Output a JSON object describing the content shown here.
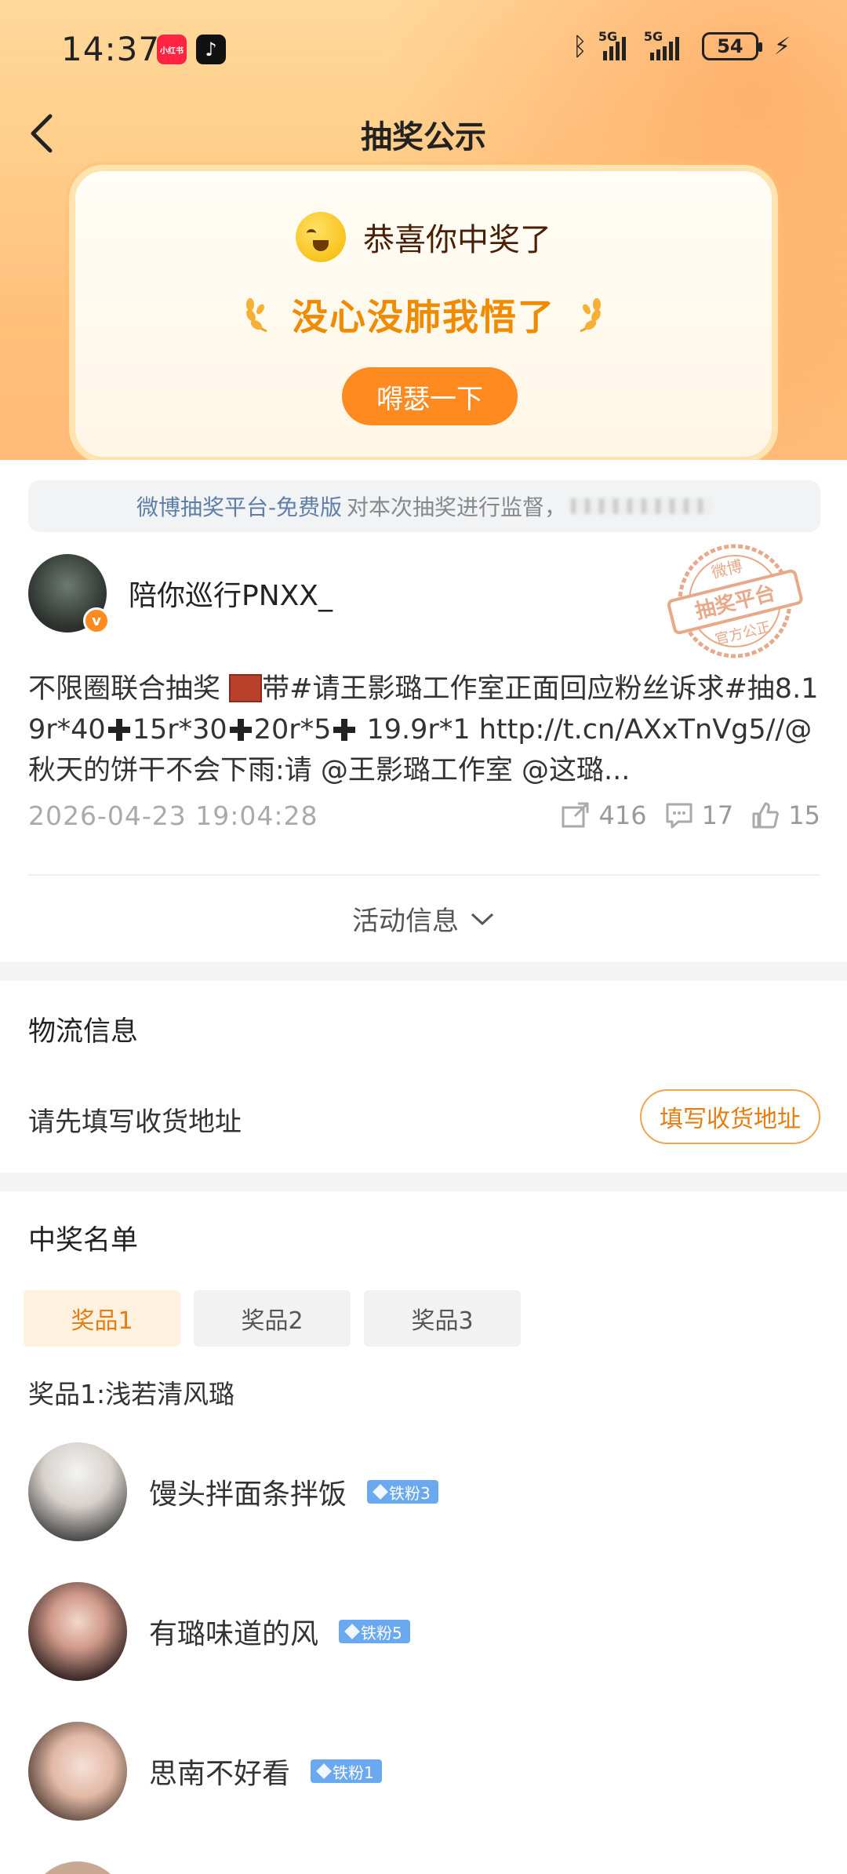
{
  "status_bar": {
    "time": "14:37",
    "app_badges": [
      "小红书",
      "♪"
    ],
    "network_1": "5G",
    "network_2": "5G",
    "battery": "54"
  },
  "header": {
    "title": "抽奖公示"
  },
  "win_card": {
    "congrats": "恭喜你中奖了",
    "winner_name": "没心没肺我悟了",
    "cta": "嘚瑟一下"
  },
  "monitor": {
    "platform": "微博抽奖平台-免费版",
    "text": "对本次抽奖进行监督，"
  },
  "post": {
    "username": "陪你巡行PNXX_",
    "stamp_lines": [
      "微博",
      "抽奖平台",
      "官方公正"
    ],
    "text_part1": "不限圈联合抽奖 ",
    "text_part2": "带#请王影璐工作室正面回应粉丝诉求#抽8.19r*40",
    "text_part3": "15r*30",
    "text_part4": "20r*5",
    "text_part5": " 19.9r*1 http://t.cn/AXxTnVg5//@秋天的饼干不会下雨:请 @王影璐工作室 @这璐...",
    "timestamp": "2026-04-23 19:04:28",
    "reposts": "416",
    "comments": "17",
    "likes": "15"
  },
  "activity": {
    "label": "活动信息"
  },
  "logistics": {
    "title": "物流信息",
    "prompt": "请先填写收货地址",
    "button": "填写收货地址"
  },
  "winners": {
    "title": "中奖名单",
    "tabs": [
      "奖品1",
      "奖品2",
      "奖品3"
    ],
    "prize_label": "奖品1:浅若清风璐",
    "list": [
      {
        "name": "馒头拌面条拌饭",
        "badge": "铁粉3"
      },
      {
        "name": "有璐味道的风",
        "badge": "铁粉5"
      },
      {
        "name": "思南不好看",
        "badge": "铁粉1"
      }
    ]
  },
  "colors": {
    "accent": "#ff8a1f",
    "winner_name": "#f08a00",
    "link": "#5d7ea6",
    "fan_badge": "#6aa9ef"
  }
}
